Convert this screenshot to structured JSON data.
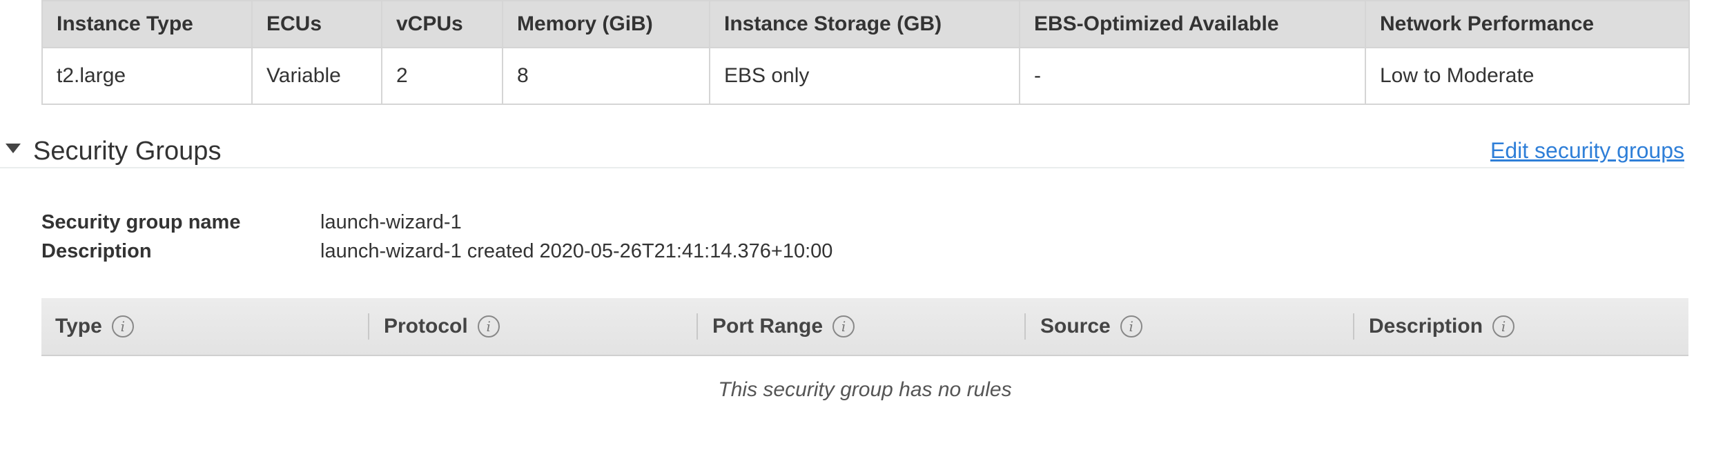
{
  "instance_table": {
    "headers": [
      "Instance Type",
      "ECUs",
      "vCPUs",
      "Memory (GiB)",
      "Instance Storage (GB)",
      "EBS-Optimized Available",
      "Network Performance"
    ],
    "row": [
      "t2.large",
      "Variable",
      "2",
      "8",
      "EBS only",
      "-",
      "Low to Moderate"
    ]
  },
  "security_groups": {
    "title": "Security Groups",
    "edit_link": "Edit security groups",
    "name_label": "Security group name",
    "name_value": "launch-wizard-1",
    "description_label": "Description",
    "description_value": "launch-wizard-1 created 2020-05-26T21:41:14.376+10:00",
    "rules_headers": [
      "Type",
      "Protocol",
      "Port Range",
      "Source",
      "Description"
    ],
    "info_icon": "info-circle-icon",
    "empty_message": "This security group has no rules"
  },
  "colors": {
    "link": "#2f7fd8",
    "header_bg": "#dddddd",
    "border": "#d5d5d5"
  }
}
